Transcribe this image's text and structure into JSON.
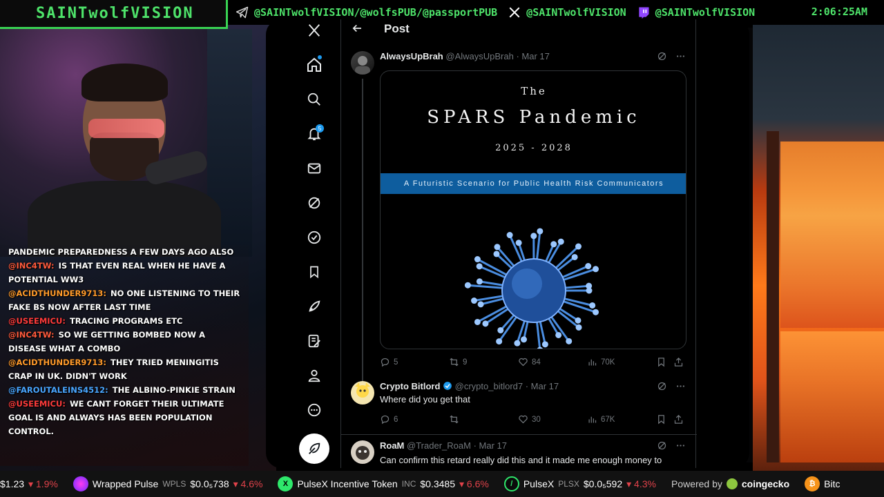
{
  "banner": {
    "brand": "SAINTwolfVISION",
    "telegram_handle": "@SAINTwolfVISION/@wolfsPUB/@passportPUB",
    "x_handle": "@SAINTwolfVISION",
    "twitch_handle": "@SAINTwolfVISION",
    "clock": "2:06:25AM",
    "accent_color": "#4ee36a"
  },
  "chat": {
    "messages": [
      {
        "user": "",
        "text": "PANDEMIC PREPAREDNESS A FEW DAYS AGO ALSO",
        "color": "#ffffff"
      },
      {
        "user": "@INC4TW:",
        "text": "IS THAT EVEN REAL WHEN HE HAVE A POTENTIAL WW3",
        "color": "#ff5a3c"
      },
      {
        "user": "@ACIDTHUNDER9713:",
        "text": "NO ONE LISTENING TO THEIR FAKE BS NOW AFTER LAST TIME",
        "color": "#ff9a2a"
      },
      {
        "user": "@USEEMICU:",
        "text": "TRACING PROGRAMS ETC",
        "color": "#ff3b3b"
      },
      {
        "user": "@INC4TW:",
        "text": "SO WE GETTING BOMBED NOW A DISEASE WHAT A COMBO",
        "color": "#ff5a3c"
      },
      {
        "user": "@ACIDTHUNDER9713:",
        "text": "THEY TRIED MENINGITIS CRAP IN UK. DIDN'T WORK",
        "color": "#ff9a2a"
      },
      {
        "user": "@FAROUTALEINS4512:",
        "text": "THE ALBINO-PINKIE STRAIN",
        "color": "#49a6ff"
      },
      {
        "user": "@USEEMICU:",
        "text": "WE CANT FORGET THEIR ULTIMATE GOAL IS AND ALWAYS HAS BEEN POPULATION CONTROL.",
        "color": "#ff3b3b"
      }
    ]
  },
  "x_app": {
    "header_title": "Post",
    "notification_count": "5",
    "main_tweet": {
      "name": "AlwaysUpBrah",
      "handle": "@AlwaysUpBrah",
      "date": "· Mar 17",
      "media": {
        "line1": "The",
        "line2": "SPARS Pandemic",
        "line3": "2025 - 2028",
        "strip": "A Futuristic Scenario for Public Health Risk Communicators"
      },
      "replies": "5",
      "reposts": "9",
      "likes": "84",
      "views": "70K"
    },
    "reply1": {
      "name": "Crypto Bitlord",
      "handle": "@crypto_bitlord7",
      "date": "· Mar 17",
      "text": "Where did you get that",
      "replies": "6",
      "reposts": "",
      "likes": "30",
      "views": "67K"
    },
    "reply2": {
      "name": "RoaM",
      "handle": "@Trader_RoaM",
      "date": "· Mar 17",
      "text": "Can confirm this retard really did this and it made me enough money to"
    }
  },
  "ticker": {
    "items": [
      {
        "price": "$1.23",
        "change": "▾ 1.9%"
      },
      {
        "name": "Wrapped Pulse",
        "symbol": "WPLS",
        "price": "$0.0₅738",
        "change": "▾ 4.6%"
      },
      {
        "name": "PulseX Incentive Token",
        "symbol": "INC",
        "price": "$0.3485",
        "change": "▾ 6.6%"
      },
      {
        "name": "PulseX",
        "symbol": "PLSX",
        "price": "$0.0₅592",
        "change": "▾ 4.3%"
      }
    ],
    "powered_by": "Powered by",
    "powered_brand": "coingecko",
    "trailing": "Bitc"
  }
}
